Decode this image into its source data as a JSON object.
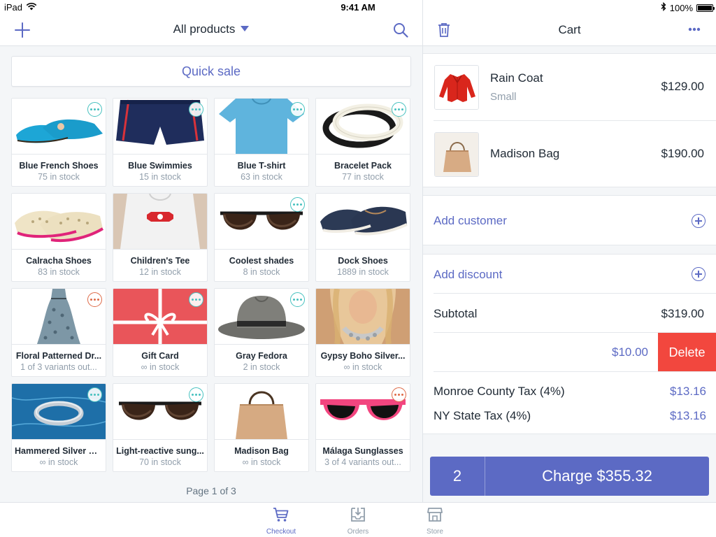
{
  "status_bar": {
    "device": "iPad",
    "time": "9:41 AM",
    "battery": "100%"
  },
  "left_header": {
    "title": "All products"
  },
  "quick_sale_label": "Quick sale",
  "products": [
    {
      "name": "Blue French Shoes",
      "stock": "75 in stock",
      "badge": "normal",
      "image": "blue-flat-shoes"
    },
    {
      "name": "Blue Swimmies",
      "stock": "15 in stock",
      "badge": "normal",
      "image": "swim-shorts"
    },
    {
      "name": "Blue T-shirt",
      "stock": "63 in stock",
      "badge": "normal",
      "image": "blue-tshirt"
    },
    {
      "name": "Bracelet Pack",
      "stock": "77 in stock",
      "badge": "normal",
      "image": "bracelets"
    },
    {
      "name": "Calracha Shoes",
      "stock": "83 in stock",
      "badge": "none",
      "image": "woven-shoes"
    },
    {
      "name": "Children's Tee",
      "stock": "12 in stock",
      "badge": "none",
      "image": "kids-tee"
    },
    {
      "name": "Coolest shades",
      "stock": "8 in stock",
      "badge": "normal",
      "image": "sunglasses"
    },
    {
      "name": "Dock Shoes",
      "stock": "1889 in stock",
      "badge": "none",
      "image": "boat-shoes"
    },
    {
      "name": "Floral Patterned Dr...",
      "stock": "1 of 3 variants out...",
      "badge": "warn",
      "image": "floral-dress"
    },
    {
      "name": "Gift Card",
      "stock": "∞ in stock",
      "badge": "normal",
      "image": "gift-card"
    },
    {
      "name": "Gray Fedora",
      "stock": "2 in stock",
      "badge": "normal",
      "image": "fedora"
    },
    {
      "name": "Gypsy Boho Silver...",
      "stock": "∞ in stock",
      "badge": "none",
      "image": "necklace"
    },
    {
      "name": "Hammered Silver Ri...",
      "stock": "∞ in stock",
      "badge": "normal",
      "image": "silver-ring"
    },
    {
      "name": "Light-reactive sung...",
      "stock": "70 in stock",
      "badge": "normal",
      "image": "sunglasses"
    },
    {
      "name": "Madison Bag",
      "stock": "∞ in stock",
      "badge": "none",
      "image": "tote-bag"
    },
    {
      "name": "Málaga Sunglasses",
      "stock": "3 of 4 variants out...",
      "badge": "warn",
      "image": "pink-sunglasses"
    }
  ],
  "pagination": "Page 1 of 3",
  "cart": {
    "title": "Cart",
    "items": [
      {
        "name": "Rain Coat",
        "variant": "Small",
        "price": "$129.00",
        "image": "red-coat"
      },
      {
        "name": "Madison Bag",
        "variant": "",
        "price": "$190.00",
        "image": "tote-bag"
      }
    ],
    "add_customer": "Add customer",
    "add_discount": "Add discount",
    "subtotal_label": "Subtotal",
    "subtotal_value": "$319.00",
    "discount_value": "$10.00",
    "delete_label": "Delete",
    "taxes": [
      {
        "label": "Monroe County Tax (4%)",
        "value": "$13.16"
      },
      {
        "label": "NY State Tax (4%)",
        "value": "$13.16"
      }
    ],
    "charge_qty": "2",
    "charge_label": "Charge $355.32"
  },
  "tabs": [
    {
      "label": "Checkout",
      "icon": "cart-icon",
      "active": true
    },
    {
      "label": "Orders",
      "icon": "inbox-icon",
      "active": false
    },
    {
      "label": "Store",
      "icon": "store-icon",
      "active": false
    }
  ],
  "colors": {
    "accent": "#5c6ac4",
    "badge": "#47c1bf",
    "badge_warn": "#de6b48",
    "delete": "#f2473e",
    "background": "#f4f6f8"
  }
}
